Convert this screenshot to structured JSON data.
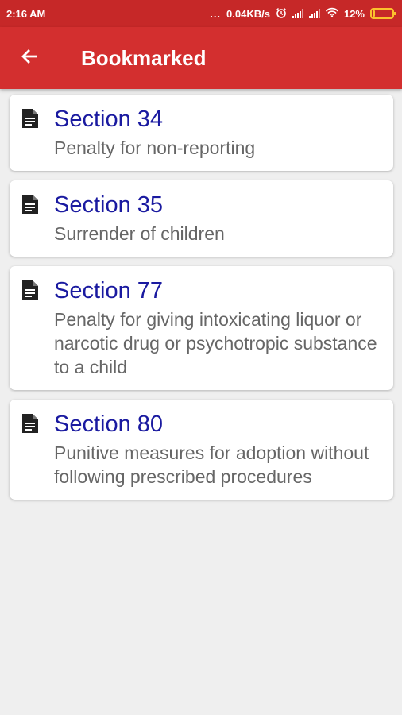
{
  "status_bar": {
    "time": "2:16 AM",
    "dots": "...",
    "net_speed": "0.04KB/s",
    "battery": "12%",
    "battery_level": 0.12,
    "icons": [
      "alarm-icon",
      "signal-icon",
      "signal-icon",
      "wifi-icon",
      "battery-icon"
    ]
  },
  "appbar": {
    "title": "Bookmarked",
    "back_icon": "arrow-left-icon"
  },
  "items": [
    {
      "section": "Section 34",
      "desc": "Penalty for non-reporting",
      "icon": "document-icon"
    },
    {
      "section": "Section 35",
      "desc": "Surrender of children",
      "icon": "document-icon"
    },
    {
      "section": "Section 77",
      "desc": "Penalty for giving intoxicating liquor or narcotic drug or psychotropic substance to a child",
      "icon": "document-icon"
    },
    {
      "section": "Section 80",
      "desc": "Punitive measures for adoption without following prescribed procedures",
      "icon": "document-icon"
    }
  ],
  "colors": {
    "status_bar": "#c62828",
    "app_bar": "#d32f2f",
    "heading": "#1a1aa0",
    "background": "#efefef"
  }
}
